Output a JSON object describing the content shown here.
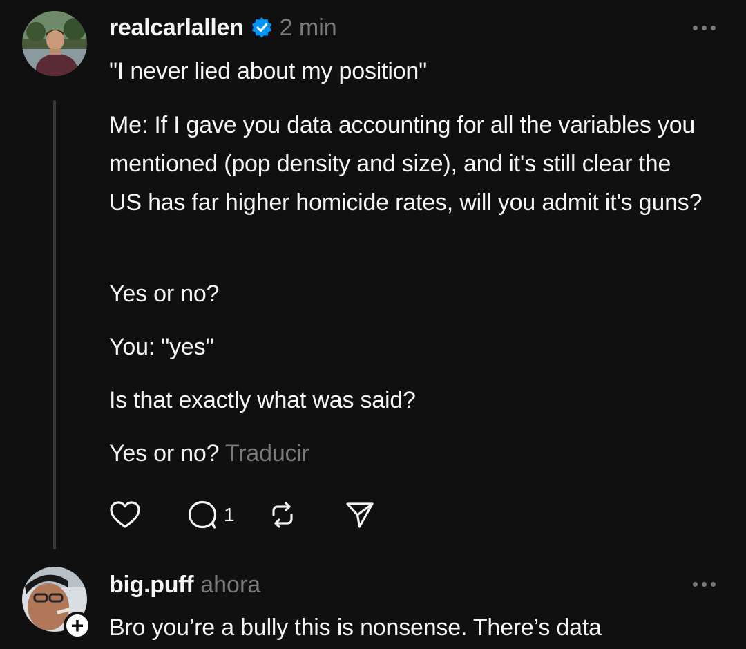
{
  "posts": [
    {
      "username": "realcarlallen",
      "verified": true,
      "time": "2 min",
      "paragraphs": [
        "\"I never lied about my position\"",
        "Me: If I gave you data accounting for all the variables you mentioned (pop density and size), and it's still clear the US has far higher homicide rates, will you admit it's guns?",
        "Yes or no?",
        "You: \"yes\"",
        "Is that exactly what was said?",
        "Yes or no?"
      ],
      "translate_label": "Traducir",
      "reply_count": "1"
    },
    {
      "username": "big.puff",
      "time": "ahora",
      "text": "Bro you’re a bully this is nonsense. There’s data"
    }
  ],
  "icons": {
    "like": "heart-icon",
    "reply": "comment-icon",
    "repost": "repost-icon",
    "share": "send-icon",
    "more": "more-horizontal-icon",
    "verified": "verified-badge-icon",
    "follow": "plus-icon"
  },
  "colors": {
    "background": "#101010",
    "text": "#f3f5f7",
    "secondary": "#7a7a7a",
    "verified": "#0095f6"
  }
}
